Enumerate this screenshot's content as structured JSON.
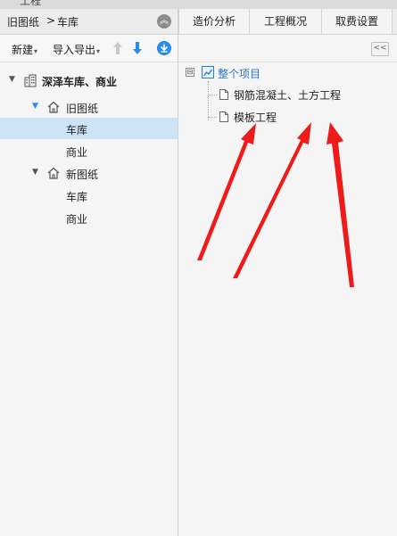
{
  "window": {
    "title_fragment": "工程"
  },
  "breadcrumb": {
    "parent": "旧图纸",
    "separator": ">",
    "current": "车库"
  },
  "toolbar": {
    "new_label": "新建",
    "import_export_label": "导入导出"
  },
  "tree": {
    "root": "深泽车库、商业",
    "old_drawings": {
      "label": "旧图纸",
      "children": [
        "车库",
        "商业"
      ]
    },
    "new_drawings": {
      "label": "新图纸",
      "children": [
        "车库",
        "商业"
      ]
    }
  },
  "tabs": [
    "造价分析",
    "工程概况",
    "取费设置"
  ],
  "project_tree": {
    "expander": "⊟",
    "root": "整个项目",
    "children": [
      "钢筋混凝土、土方工程",
      "模板工程"
    ]
  },
  "colors": {
    "accent": "#2a8ce6",
    "selected_row": "#cde4f7",
    "annotation_arrow": "#ee1b1b"
  },
  "icons": [
    "collapse-up-icon",
    "move-up-icon",
    "move-down-icon",
    "download-icon",
    "building-icon",
    "house-icon",
    "collapse-panel-icon",
    "project-icon",
    "document-icon"
  ]
}
